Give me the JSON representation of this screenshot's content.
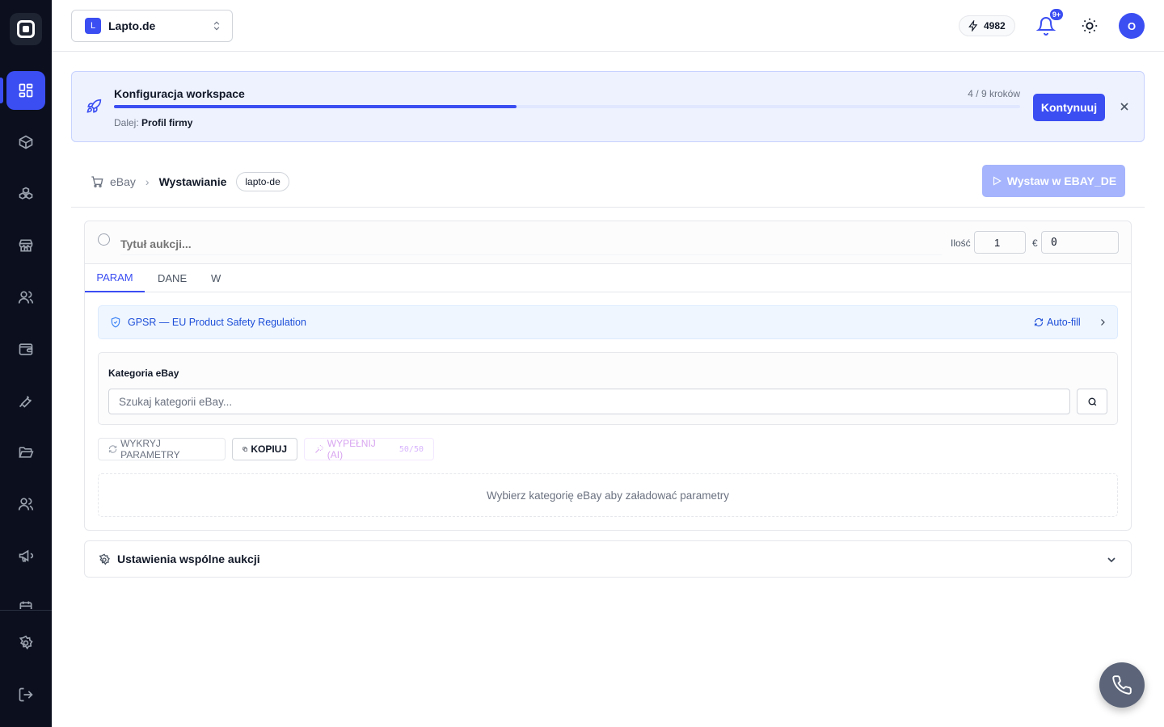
{
  "workspace": {
    "badge": "L",
    "name": "Lapto.de"
  },
  "header": {
    "credits": "4982",
    "notifications_badge": "9+",
    "avatar_initial": "O"
  },
  "setup": {
    "title": "Konfiguracja workspace",
    "steps": "4 / 9 kroków",
    "progress": 0.444,
    "next_prefix": "Dalej:",
    "next_step": "Profil firmy",
    "continue_label": "Kontynuuj"
  },
  "breadcrumb": {
    "root": "eBay",
    "current": "Wystawianie",
    "tag": "lapto-de"
  },
  "list_button": "Wystaw w EBAY_DE",
  "auction": {
    "title_placeholder": "Tytuł aukcji...",
    "qty_label": "Ilość",
    "qty_value": "1",
    "currency_label": "€",
    "price_value": "0"
  },
  "tabs": [
    {
      "label": "PARAM",
      "active": true
    },
    {
      "label": "DANE",
      "active": false
    },
    {
      "label": "W",
      "active": false
    }
  ],
  "gpsr": {
    "text": "GPSR — EU Product Safety Regulation",
    "autofill": "Auto-fill"
  },
  "category": {
    "label": "Kategoria eBay",
    "placeholder": "Szukaj kategorii eBay..."
  },
  "actions": {
    "detect": "WYKRYJ PARAMETRY",
    "copy": "KOPIUJ",
    "ai_fill": "WYPEŁNIJ (AI)",
    "ai_count": "50/50"
  },
  "empty_state": "Wybierz kategorię eBay aby załadować parametry",
  "shared_settings": "Ustawienia wspólne aukcji",
  "colors": {
    "accent": "#3b4ef2",
    "sidebar": "#0b0f1e"
  }
}
